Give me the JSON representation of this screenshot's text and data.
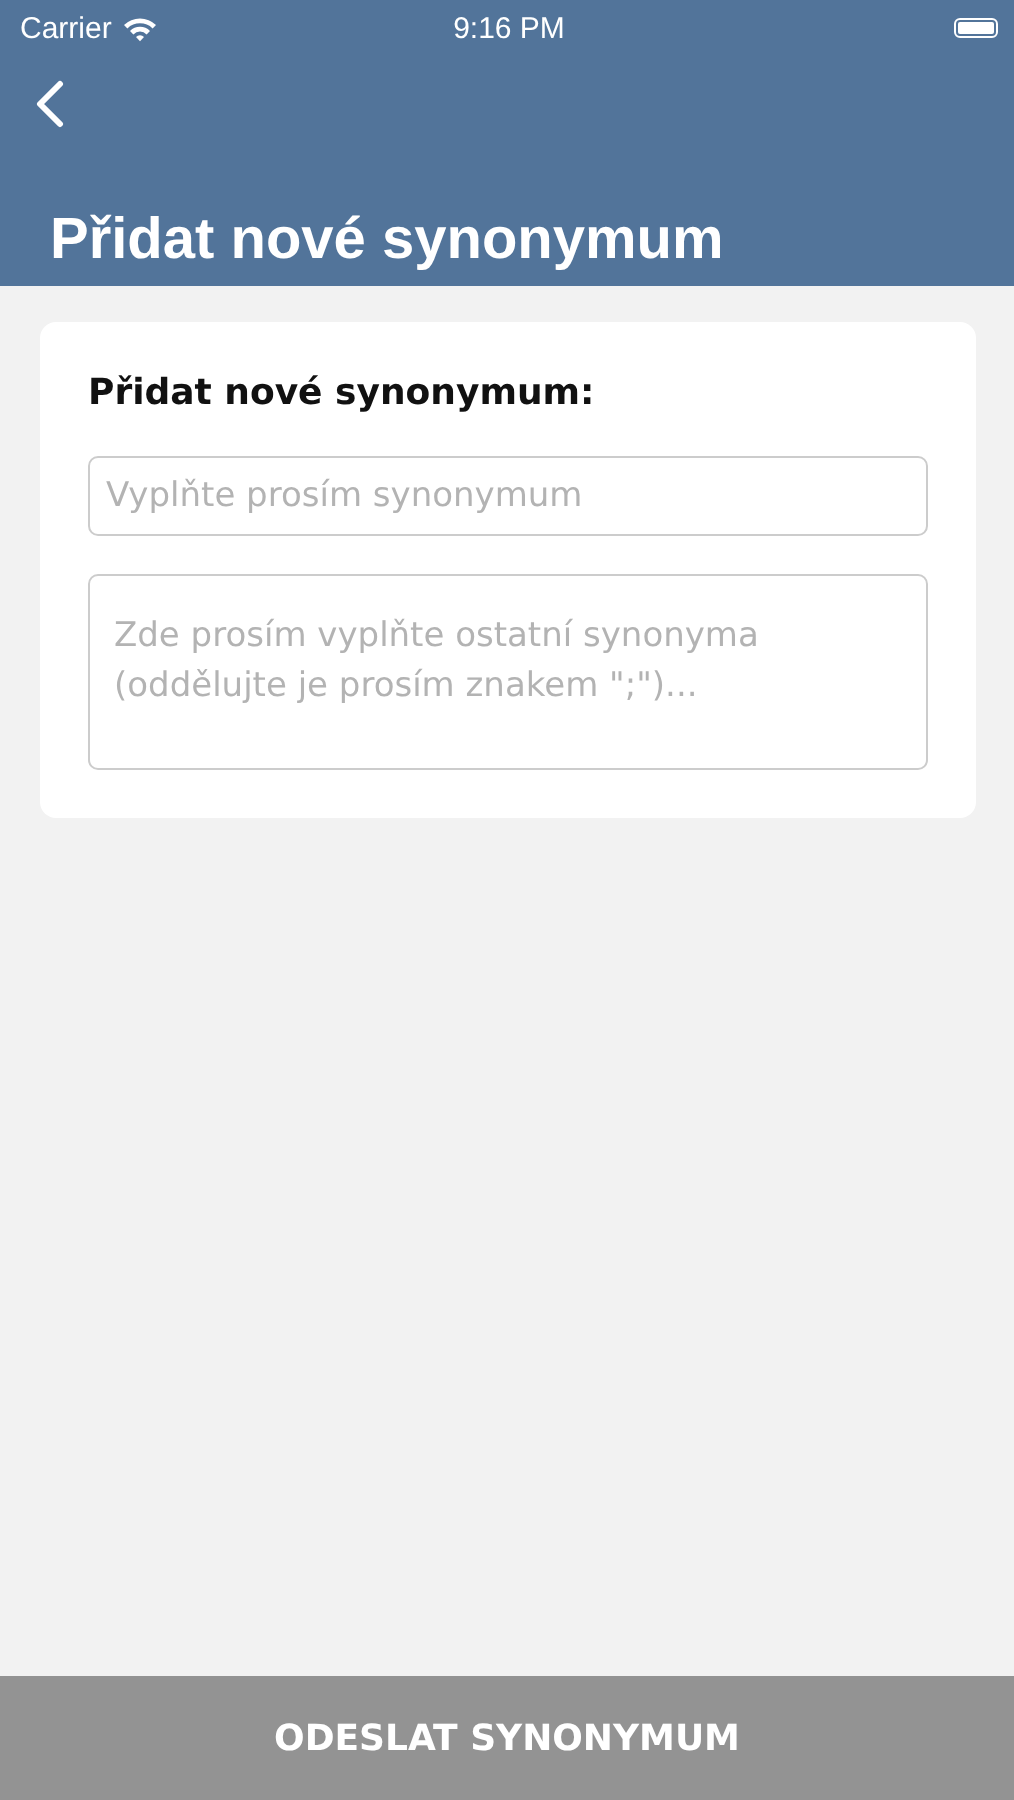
{
  "status_bar": {
    "carrier": "Carrier",
    "time": "9:16 PM"
  },
  "nav": {
    "title": "Přidat nové synonymum"
  },
  "form": {
    "heading": "Přidat nové synonymum:",
    "fields": [
      {
        "kind": "line",
        "placeholder": "Vyplňte prosím synonymum"
      },
      {
        "kind": "area",
        "placeholder": "Zde prosím vyplňte ostatní synonyma (oddělujte je prosím znakem \";\")..."
      }
    ]
  },
  "submit": {
    "label": "ODESLAT SYNONYMUM",
    "disabled": true
  }
}
